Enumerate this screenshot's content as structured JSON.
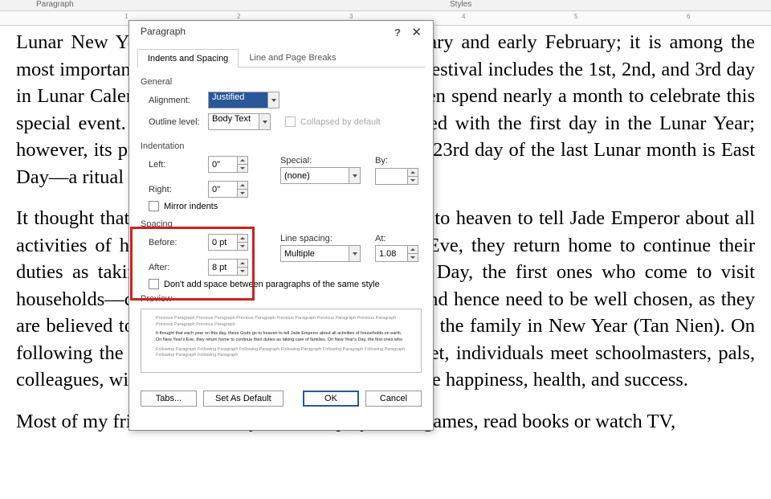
{
  "ribbon": {
    "left_label": "Paragraph",
    "right_label": "Styles"
  },
  "ruler_numbers": [
    "1",
    "2",
    "3",
    "4",
    "5",
    "6"
  ],
  "document": {
    "p1": "Lunar New Year, typically falls between late January and early February; it is among the most important holidays in Vietnam. Officially, the festival includes the 1st, 2nd, and 3rd day in Lunar Calendar; however, Vietnamese people often spend nearly a month to celebrate this special event. Tet Holiday gets its beginning marked with the first day in the Lunar Year; however, its preparation starts long before that. The 23rd day of the last Lunar month is East Day—a ritual worshiping Kitchen Gods (Tao Cong).",
    "p2": "It thought that each year on this day, these Gods go to heaven to tell Jade Emperor about all activities of households on earth. On New Year's Eve, they return home to continue their duties as taking care of families. On New Year's Day, the first ones who come to visit households—called first-foot—are very important and hence need to be well chosen, as they are believed to hold in their hands the entire luck of the family in New Year (Tan Nien). On following the third day or even the fourth day of Tet, individuals meet schoolmasters, pals, colleagues, wishing them all kinds of good things like happiness, health, and success.",
    "p3": "Most of my friends like to stay inside to play video games, read books or watch TV,"
  },
  "dialog": {
    "title": "Paragraph",
    "tabs": {
      "indents": "Indents and Spacing",
      "breaks": "Line and Page Breaks"
    },
    "general": {
      "label": "General",
      "alignment_label": "Alignment:",
      "alignment_value": "Justified",
      "outline_label": "Outline level:",
      "outline_value": "Body Text",
      "collapsed_label": "Collapsed by default"
    },
    "indentation": {
      "label": "Indentation",
      "left_label": "Left:",
      "left_value": "0\"",
      "right_label": "Right:",
      "right_value": "0\"",
      "special_label": "Special:",
      "special_value": "(none)",
      "by_label": "By:",
      "by_value": "",
      "mirror_label": "Mirror indents"
    },
    "spacing": {
      "label": "Spacing",
      "before_label": "Before:",
      "before_value": "0 pt",
      "after_label": "After:",
      "after_value": "8 pt",
      "line_label": "Line spacing:",
      "line_value": "Multiple",
      "at_label": "At:",
      "at_value": "1.08",
      "noadd_label": "Don't add space between paragraphs of the same style"
    },
    "preview": {
      "label": "Preview",
      "grey": "Previous Paragraph Previous Paragraph Previous Paragraph Previous Paragraph Previous Paragraph Previous Paragraph Previous Paragraph Previous Paragraph",
      "dark": "It thought that each year on this day, these Gods go to heaven to tell Jade Emperor about all activities of households on earth. On New Year's Eve, they return home to continue their duties as taking care of families. On New Year's Day, the first ones who",
      "grey2": "Following Paragraph Following Paragraph Following Paragraph Following Paragraph Following Paragraph Following Paragraph Following Paragraph Following Paragraph"
    },
    "buttons": {
      "tabs": "Tabs...",
      "default": "Set As Default",
      "ok": "OK",
      "cancel": "Cancel"
    }
  }
}
